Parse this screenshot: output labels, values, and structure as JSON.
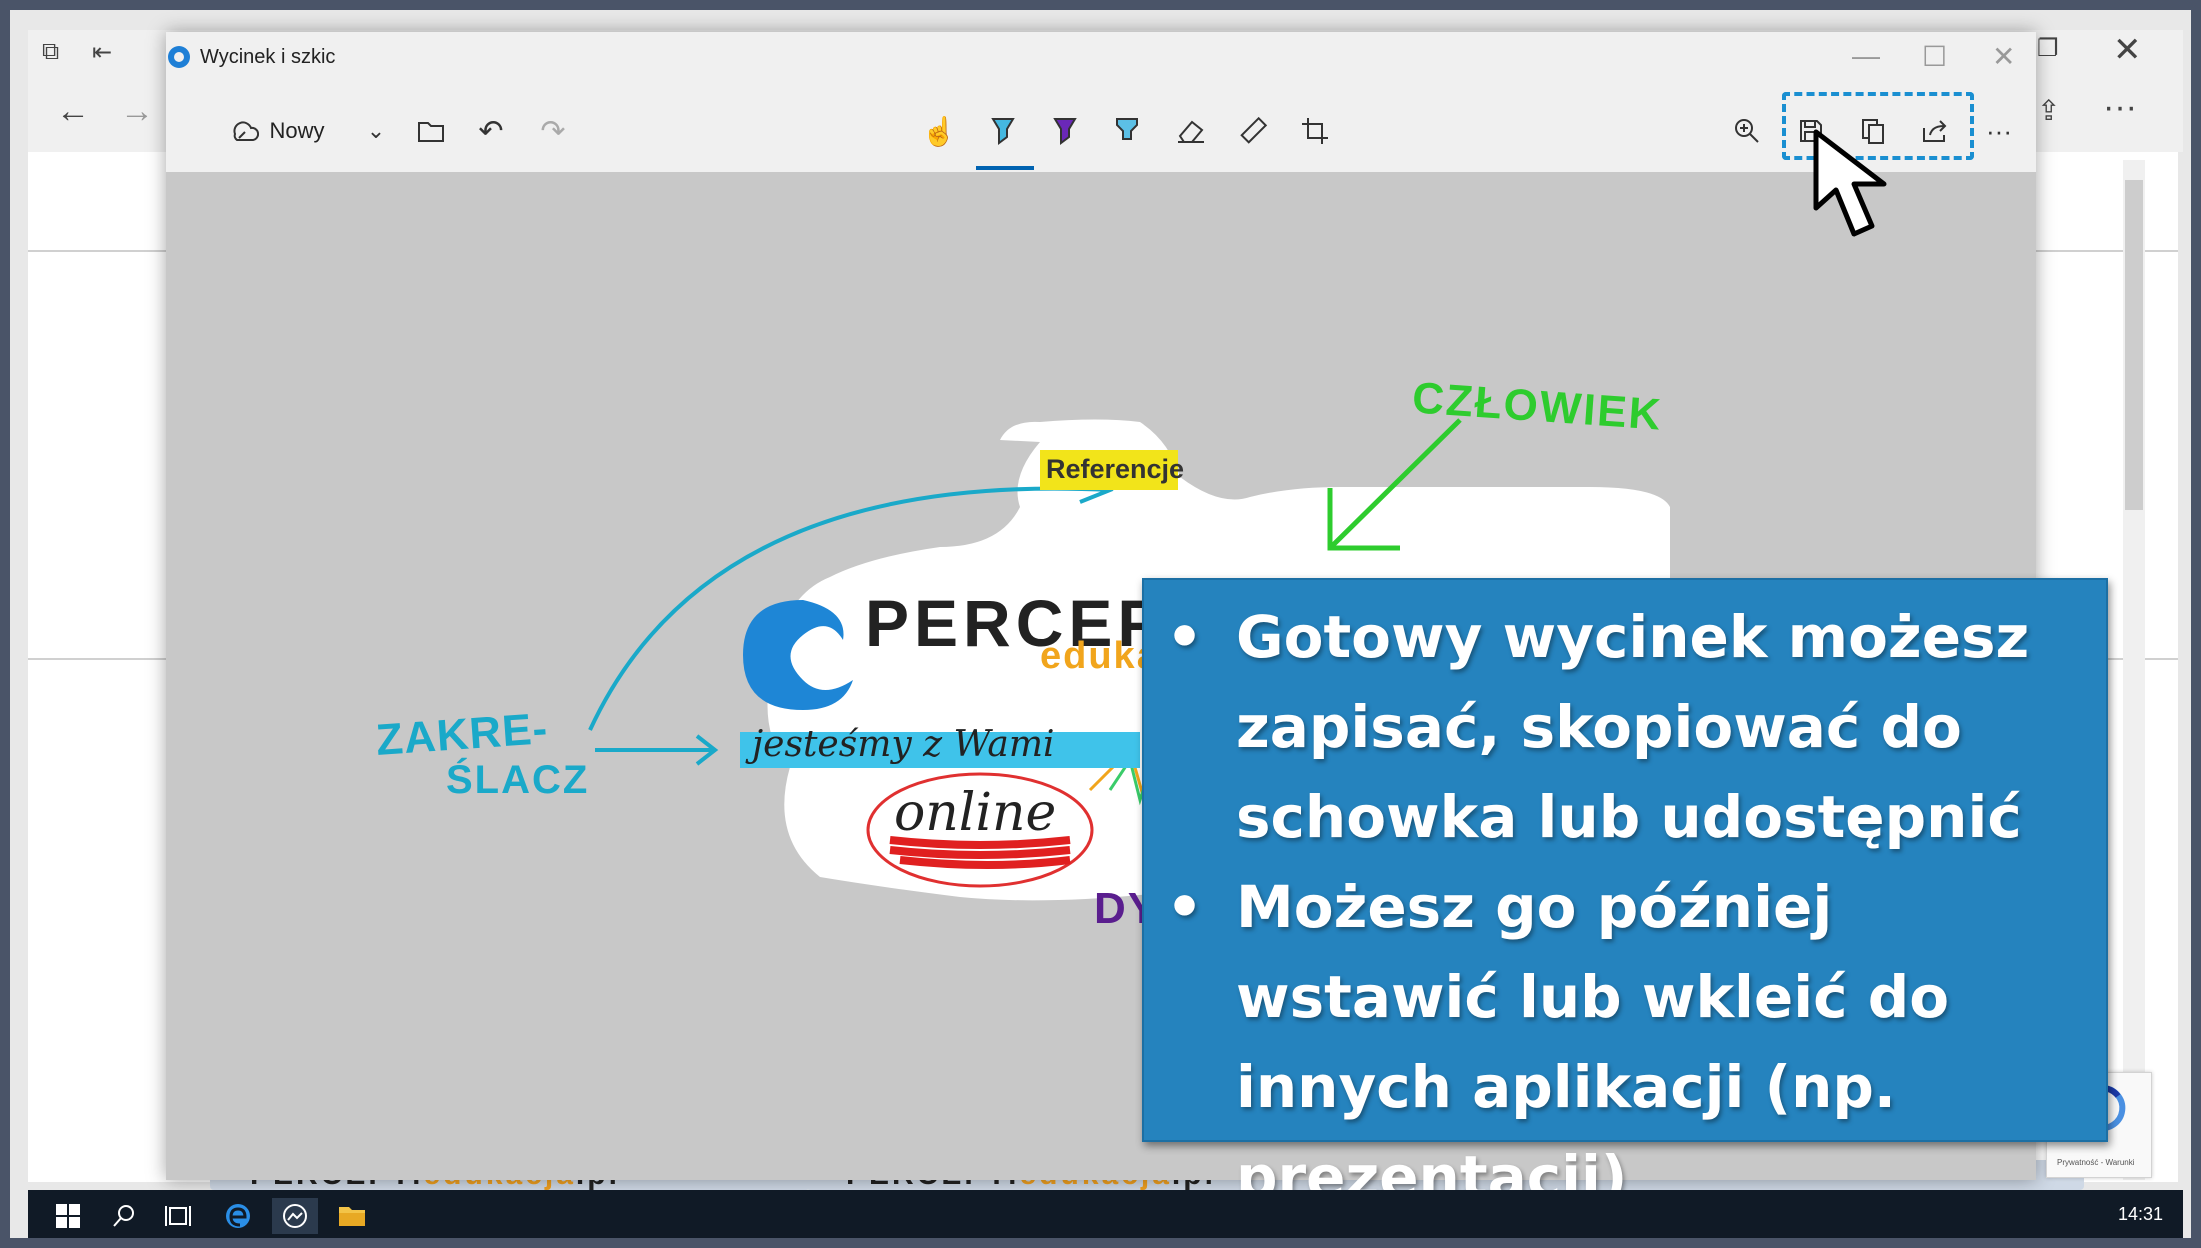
{
  "window": {
    "title": "Wycinek i szkic"
  },
  "toolbar": {
    "new_label": "Nowy",
    "more": "···",
    "share_more": "···"
  },
  "canvas": {
    "highlight_text": "Referencje",
    "logo_main": "PERCEPTi",
    "logo_sub": "edukacja",
    "slogan": "jesteśmy z Wami",
    "online": "online",
    "annotation_czlowiek": "CZŁOWIEK",
    "annotation_zakreslacz_1": "ZAKRE-",
    "annotation_zakreslacz_2": "ŚLACZ",
    "annotation_dy": "DY"
  },
  "callout": {
    "items": [
      "Gotowy wycinek możesz zapisać, skopiować do schowka lub udostępnić",
      "Możesz go później wstawić lub wkleić do innych aplikacji (np. prezentacji)"
    ]
  },
  "background": {
    "card_left": "PERCEPTi",
    "card_left_accent": "edukacja",
    "card_left_suffix": ".pl",
    "card_mid": "PERCEPTi",
    "card_mid_accent": "edukacja",
    "card_mid_suffix": ".pl",
    "recaptcha_text": "Prywatność - Warunki"
  },
  "taskbar": {
    "time": "14:31"
  },
  "colors": {
    "callout_bg": "#2583be",
    "highlight": "#f2e41a",
    "pen_blue": "#1aa9c9",
    "pen_green": "#2ecc2e",
    "accent": "#0063b1"
  },
  "icons": [
    "back-icon",
    "forward-icon",
    "edge-icon",
    "touch-writing-icon",
    "ballpoint-pen-icon",
    "pencil-icon",
    "highlighter-icon",
    "eraser-icon",
    "ruler-icon",
    "crop-icon",
    "zoom-icon",
    "save-icon",
    "copy-icon",
    "share-icon",
    "undo-icon",
    "redo-icon",
    "folder-icon",
    "windows-icon",
    "search-icon",
    "task-view-icon",
    "file-explorer-icon"
  ]
}
